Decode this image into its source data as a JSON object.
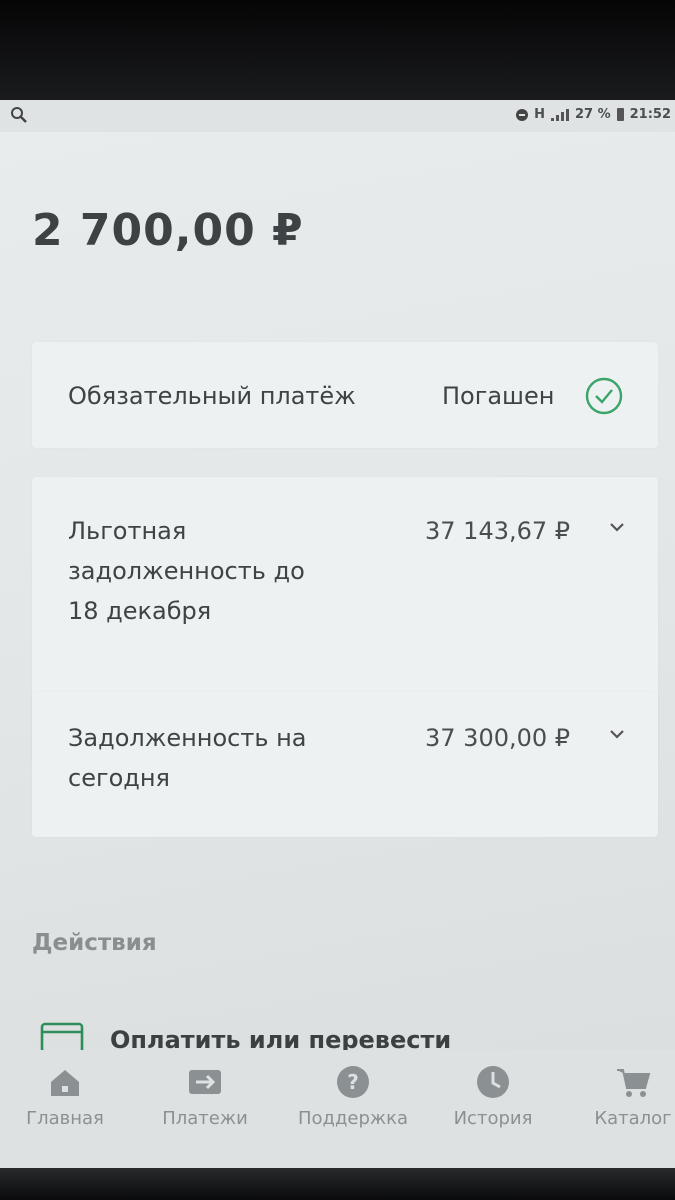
{
  "status_bar": {
    "network": "H",
    "battery": "27 %",
    "time": "21:52"
  },
  "balance": "2 700,00 ₽",
  "cards": {
    "mandatory": {
      "label": "Обязательный платёж",
      "status": "Погашен"
    },
    "grace_debt": {
      "label": "Льготная задолженность до 18 декабря",
      "value": "37 143,67 ₽"
    },
    "debt_today": {
      "label": "Задолженность на сегодня",
      "value": "37 300,00 ₽"
    }
  },
  "actions": {
    "title": "Действия",
    "pay_transfer": "Оплатить или перевести"
  },
  "tabbar": {
    "home": "Главная",
    "payments": "Платежи",
    "support": "Поддержка",
    "history": "История",
    "catalog": "Каталог"
  },
  "colors": {
    "accent_green": "#3aa46a",
    "text": "#3f4345",
    "muted": "#8b9092"
  }
}
